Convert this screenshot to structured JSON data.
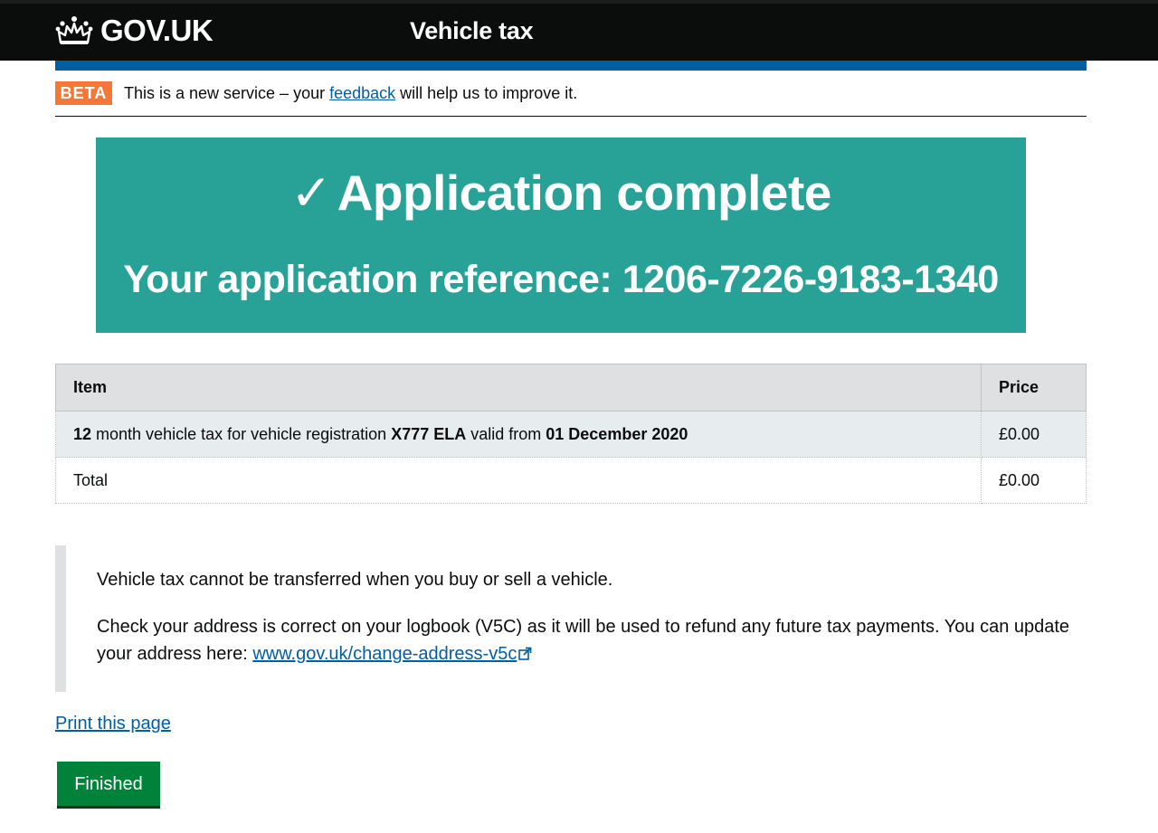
{
  "header": {
    "logo_text": "GOV.UK",
    "service_name": "Vehicle tax"
  },
  "phase_banner": {
    "tag": "BETA",
    "text_before": "This is a new service – your ",
    "link_text": "feedback",
    "text_after": " will help us to improve it."
  },
  "confirmation": {
    "check_mark": "✓",
    "title": "Application complete",
    "reference_label": "Your application reference: ",
    "reference_number": "1206-7226-9183-1340"
  },
  "table": {
    "headers": [
      "Item",
      "Price"
    ],
    "item": {
      "months": "12",
      "text1": " month vehicle tax for vehicle registration ",
      "registration": "X777 ELA",
      "text2": " valid from ",
      "valid_from": "01 December 2020",
      "price": "£0.00"
    },
    "total": {
      "label": "Total",
      "price": "£0.00"
    }
  },
  "notice": {
    "line1": "Vehicle tax cannot be transferred when you buy or sell a vehicle.",
    "line2": "Check your address is correct on your logbook (V5C) as it will be used to refund any future tax payments. You can update your address here: ",
    "link_text": "www.gov.uk/change-address-v5c"
  },
  "actions": {
    "print_link": "Print this page",
    "finished_button": "Finished"
  },
  "colors": {
    "header_bg": "#0b0c0c",
    "accent_blue": "#005ea5",
    "beta_tag": "#f47738",
    "panel_turquoise": "#28a197",
    "button_green": "#00823b"
  }
}
